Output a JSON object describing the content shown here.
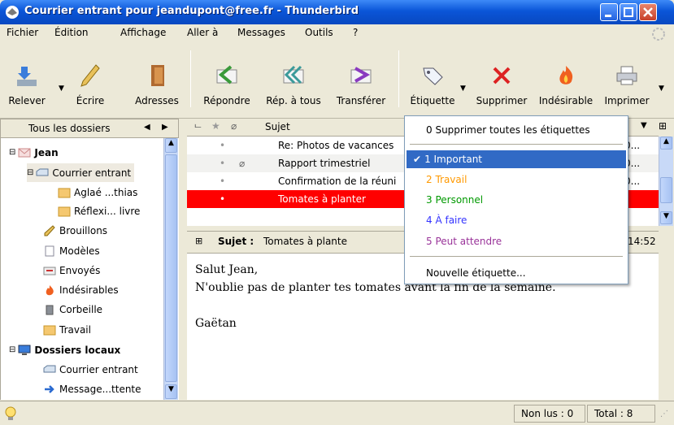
{
  "window": {
    "title": "Courrier entrant pour jeandupont@free.fr - Thunderbird"
  },
  "menu": [
    {
      "label": "Fichier"
    },
    {
      "label": "Édition"
    },
    {
      "label": "Affichage"
    },
    {
      "label": "Aller à"
    },
    {
      "label": "Messages"
    },
    {
      "label": "Outils"
    },
    {
      "label": "?"
    }
  ],
  "toolbar": {
    "relever": "Relever",
    "ecrire": "Écrire",
    "adresses": "Adresses",
    "repondre": "Répondre",
    "rep_tous": "Rép. à tous",
    "transferer": "Transférer",
    "etiquette": "Étiquette",
    "supprimer": "Supprimer",
    "indesirable": "Indésirable",
    "imprimer": "Imprimer"
  },
  "folders": {
    "header": "Tous les dossiers",
    "items": [
      {
        "label": "Jean",
        "icon": "account-icon",
        "bold": true
      },
      {
        "label": "Courrier entrant",
        "icon": "inbox-icon"
      },
      {
        "label": "Aglaé ...thias",
        "icon": "folder-icon"
      },
      {
        "label": "Réflexi... livre",
        "icon": "folder-icon"
      },
      {
        "label": "Brouillons",
        "icon": "drafts-icon"
      },
      {
        "label": "Modèles",
        "icon": "templates-icon"
      },
      {
        "label": "Envoyés",
        "icon": "sent-icon"
      },
      {
        "label": "Indésirables",
        "icon": "junk-icon"
      },
      {
        "label": "Corbeille",
        "icon": "trash-icon"
      },
      {
        "label": "Travail",
        "icon": "folder-icon"
      },
      {
        "label": "Dossiers locaux",
        "icon": "local-folders-icon",
        "bold": true
      },
      {
        "label": "Courrier entrant",
        "icon": "inbox-icon"
      },
      {
        "label": "Message...ttente",
        "icon": "outbox-icon"
      }
    ]
  },
  "threads": {
    "column_subject": "Sujet",
    "rows": [
      {
        "subject": "Re: Photos de vacances",
        "date": "0...",
        "attachment": false,
        "selected": false
      },
      {
        "subject": "Rapport trimestriel",
        "date": "0...",
        "attachment": true,
        "selected": false
      },
      {
        "subject": "Confirmation de la réuni",
        "date": "0...",
        "attachment": false,
        "selected": false
      },
      {
        "subject": "Tomates à planter",
        "date": "",
        "attachment": false,
        "selected": true
      }
    ]
  },
  "message": {
    "subject_label": "Sujet :",
    "subject": "Tomates à plante",
    "time": "14:52",
    "body": [
      "Salut Jean,",
      "N'oublie pas de planter tes tomates avant la fin de la semaine.",
      "",
      "Gaëtan"
    ]
  },
  "label_menu": {
    "remove_all": "0 Supprimer toutes les étiquettes",
    "items": [
      {
        "label": "1 Important",
        "color": "#ffffff",
        "checked": true
      },
      {
        "label": "2 Travail",
        "color": "#ff9900"
      },
      {
        "label": "3 Personnel",
        "color": "#009900"
      },
      {
        "label": "4 À faire",
        "color": "#3333ff"
      },
      {
        "label": "5 Peut attendre",
        "color": "#993399"
      }
    ],
    "new_label": "Nouvelle étiquette..."
  },
  "status": {
    "unread": "Non lus : 0",
    "total": "Total : 8"
  },
  "colors": {
    "selection_red": "#ff0000",
    "menu_highlight": "#316ac5"
  }
}
